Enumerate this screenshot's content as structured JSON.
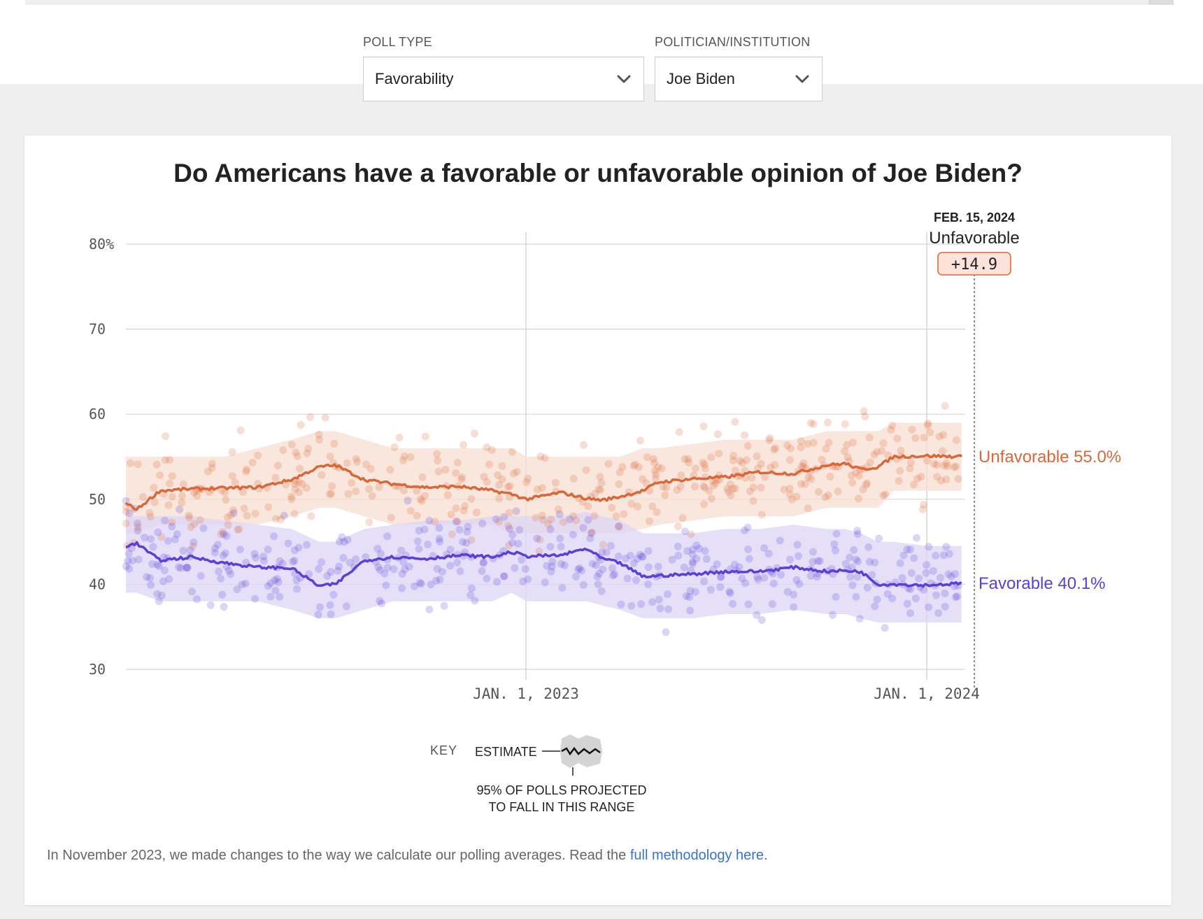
{
  "filters": {
    "poll_type": {
      "label": "POLL TYPE",
      "value": "Favorability"
    },
    "politician": {
      "label": "POLITICIAN/INSTITUTION",
      "value": "Joe Biden"
    }
  },
  "icons": {
    "dropdown": "chevron-down-icon"
  },
  "colors": {
    "unfavorable": "#d9673a",
    "favorable": "#5b3fd6",
    "unfavorable_band": "#f7ddd0",
    "favorable_band": "#dcd6f5",
    "badge_fill": "#fbe3da",
    "link": "#3a73c8"
  },
  "tooltip": {
    "date": "FEB. 15, 2024",
    "leader": "Unfavorable",
    "margin": "+14.9"
  },
  "key": {
    "label": "KEY",
    "estimate": "ESTIMATE",
    "range_line1": "95% OF POLLS PROJECTED",
    "range_line2": "TO FALL IN THIS RANGE"
  },
  "footnote": {
    "text": "In November 2023, we made changes to the way we calculate our polling averages. Read the ",
    "link": "full methodology here",
    "end": "."
  },
  "chart_data": {
    "type": "line",
    "title": "Do Americans have a favorable or unfavorable opinion of Joe Biden?",
    "ylim": [
      30,
      80
    ],
    "y_ticks": [
      "80%",
      "70",
      "60",
      "50",
      "40",
      "30"
    ],
    "x_ticks": [
      "JAN. 1, 2023",
      "JAN. 1, 2024"
    ],
    "grid": true,
    "series": [
      {
        "name": "Unfavorable",
        "end_label": "Unfavorable 55.0%",
        "x": [
          "2022-01-15",
          "2022-01-25",
          "2022-02-15",
          "2022-03-15",
          "2022-04-15",
          "2022-05-15",
          "2022-06-15",
          "2022-07-10",
          "2022-07-25",
          "2022-08-20",
          "2022-09-15",
          "2022-10-15",
          "2022-11-15",
          "2022-12-15",
          "2023-01-01",
          "2023-01-15",
          "2023-02-15",
          "2023-03-10",
          "2023-03-25",
          "2023-04-10",
          "2023-05-01",
          "2023-05-15",
          "2023-06-15",
          "2023-07-15",
          "2023-08-15",
          "2023-09-15",
          "2023-10-15",
          "2023-11-01",
          "2023-11-15",
          "2023-12-01",
          "2023-12-15",
          "2024-01-15",
          "2024-02-15"
        ],
        "values": [
          49.5,
          48.8,
          51.0,
          51.2,
          51.3,
          51.4,
          52.3,
          53.8,
          54.0,
          52.3,
          51.8,
          51.4,
          51.5,
          51.0,
          50.6,
          50.0,
          50.8,
          50.1,
          49.9,
          50.3,
          51.0,
          52.0,
          52.4,
          52.6,
          53.2,
          53.0,
          54.0,
          54.2,
          53.5,
          53.8,
          55.0,
          55.1,
          55.0
        ],
        "band_lo": [
          46,
          46,
          47,
          47,
          47,
          47,
          48,
          49,
          49,
          48,
          47,
          47,
          47,
          47,
          46,
          46,
          46,
          46,
          46,
          46,
          46.5,
          47,
          47.5,
          48,
          48,
          48,
          49,
          49,
          49,
          49,
          51,
          51,
          51
        ],
        "band_hi": [
          55,
          55,
          55,
          55,
          55,
          56,
          57,
          58,
          58,
          57,
          56,
          56,
          56,
          56,
          56,
          55,
          55,
          55,
          55,
          55,
          56,
          56,
          56.5,
          57,
          57,
          57,
          58,
          58,
          58,
          58,
          59,
          59,
          59
        ]
      },
      {
        "name": "Favorable",
        "end_label": "Favorable 40.1%",
        "x": [
          "2022-01-15",
          "2022-01-25",
          "2022-02-15",
          "2022-03-15",
          "2022-04-15",
          "2022-05-15",
          "2022-06-15",
          "2022-07-10",
          "2022-07-25",
          "2022-08-20",
          "2022-09-15",
          "2022-10-15",
          "2022-11-15",
          "2022-12-15",
          "2023-01-01",
          "2023-01-15",
          "2023-02-15",
          "2023-03-10",
          "2023-03-25",
          "2023-04-10",
          "2023-05-01",
          "2023-05-15",
          "2023-06-15",
          "2023-07-15",
          "2023-08-15",
          "2023-09-15",
          "2023-10-15",
          "2023-11-01",
          "2023-11-15",
          "2023-12-01",
          "2023-12-15",
          "2024-01-15",
          "2024-02-15"
        ],
        "values": [
          44.5,
          44.8,
          42.8,
          43.2,
          42.5,
          42.0,
          41.9,
          39.8,
          40.0,
          42.8,
          43.2,
          43.0,
          43.4,
          43.2,
          43.8,
          43.3,
          43.4,
          44.2,
          43.0,
          42.5,
          40.9,
          41.0,
          41.2,
          41.5,
          41.5,
          42.0,
          41.5,
          41.6,
          41.5,
          40.0,
          40.0,
          39.9,
          40.1
        ],
        "band_lo": [
          39,
          39,
          38,
          38,
          38,
          38,
          37,
          36,
          36,
          37,
          38,
          38,
          38,
          38,
          39,
          38,
          38,
          38,
          37.5,
          37,
          36,
          36,
          36,
          36.5,
          36.5,
          37,
          36.5,
          36.5,
          36,
          35.5,
          35.5,
          35.5,
          35.5
        ],
        "band_hi": [
          48,
          48,
          48,
          48,
          47.5,
          47,
          46.5,
          45,
          45,
          46.5,
          47,
          47.5,
          47.5,
          48,
          48,
          48,
          48,
          48.5,
          48,
          47.5,
          46,
          46,
          46,
          46.5,
          46.5,
          47,
          46.5,
          46.5,
          46,
          45,
          45,
          44.5,
          44.5
        ]
      }
    ]
  }
}
